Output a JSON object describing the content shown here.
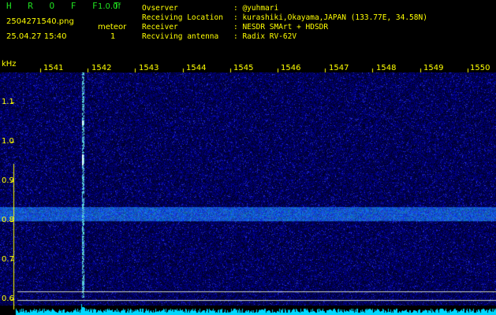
{
  "header": {
    "title": "H R O F F T",
    "version": "1.0.0f",
    "filename": "2504271540.png",
    "datetime": "25.04.27 15:40",
    "mode_label": "meteor",
    "count": "1",
    "info_labels": [
      "Ovserver",
      "Receiving Location",
      "Receiver",
      "Recviving antenna"
    ],
    "info_values": [
      ": @yuhmari",
      ": kurashiki,Okayama,JAPAN (133.77E, 34.58N)",
      ": NESDR SMArt + HDSDR",
      ": Radix RV-62V"
    ]
  },
  "axes": {
    "y_unit": "kHz",
    "x_ticks": [
      "1541",
      "1542",
      "1543",
      "1544",
      "1545",
      "1546",
      "1547",
      "1548",
      "1549",
      "1550"
    ],
    "y_ticks": [
      "1.1",
      "1.0",
      "0.9",
      "0.8",
      "0.7",
      "0.6"
    ]
  },
  "colors": {
    "background": "#000000",
    "noise": "#0a0a8a",
    "text": "#ffff00",
    "title": "#20e020",
    "signal": "#4a6cff",
    "spectrum": "#00d8ff"
  }
}
